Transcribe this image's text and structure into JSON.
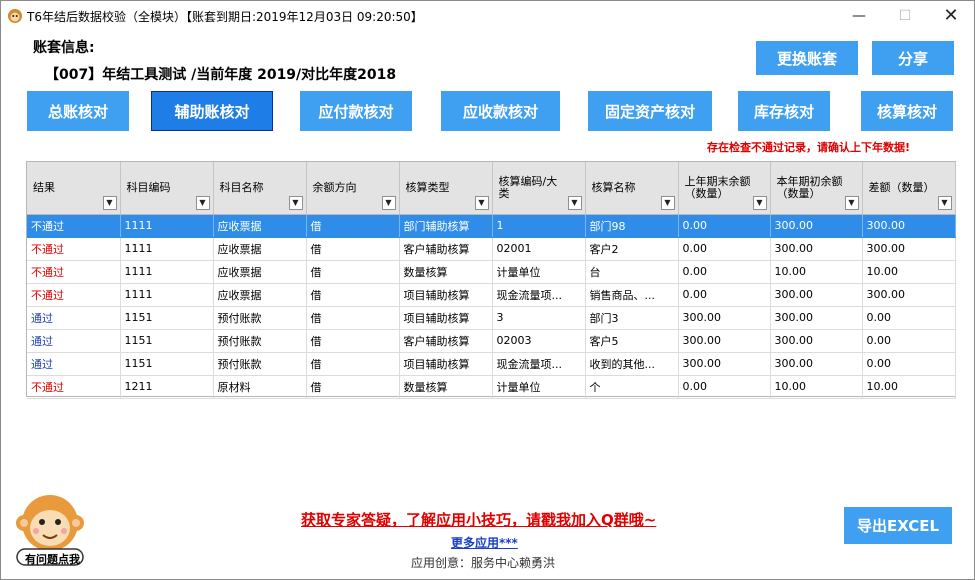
{
  "window": {
    "title": "T6年结后数据校验（全模块）【账套到期日:2019年12月03日 09:20:50】",
    "controls": {
      "minimize": "—",
      "maximize": "☐",
      "close": "✕"
    }
  },
  "account": {
    "label": "账套信息:",
    "info": "【007】年结工具测试 /当前年度 2019/对比年度2018"
  },
  "top_buttons": {
    "switch_account": "更换账套",
    "share": "分享"
  },
  "tabs": [
    {
      "label": "总账核对",
      "active": false
    },
    {
      "label": "辅助账核对",
      "active": true
    },
    {
      "label": "应付款核对",
      "active": false
    },
    {
      "label": "应收款核对",
      "active": false
    },
    {
      "label": "固定资产核对",
      "active": false
    },
    {
      "label": "库存核对",
      "active": false
    },
    {
      "label": "核算核对",
      "active": false
    }
  ],
  "warning": "存在检查不通过记录，请确认上下年数据!",
  "table": {
    "columns": [
      {
        "key": "result",
        "label": "结果"
      },
      {
        "key": "code",
        "label": "科目编码"
      },
      {
        "key": "name",
        "label": "科目名称"
      },
      {
        "key": "direction",
        "label": "余额方向"
      },
      {
        "key": "acc_type",
        "label": "核算类型"
      },
      {
        "key": "acc_code",
        "label": "核算编码/大类"
      },
      {
        "key": "acc_name",
        "label": "核算名称"
      },
      {
        "key": "prev_end",
        "label": "上年期末余额（数量）"
      },
      {
        "key": "curr_begin",
        "label": "本年期初余额（数量）"
      },
      {
        "key": "diff",
        "label": "差额（数量）"
      }
    ],
    "rows": [
      {
        "status": "fail",
        "cells": [
          "不通过",
          "1111",
          "应收票据",
          "借",
          "部门辅助核算",
          "1",
          "部门98",
          "0.00",
          "300.00",
          "300.00"
        ]
      },
      {
        "status": "fail",
        "cells": [
          "不通过",
          "1111",
          "应收票据",
          "借",
          "客户辅助核算",
          "02001",
          "客户2",
          "0.00",
          "300.00",
          "300.00"
        ]
      },
      {
        "status": "fail",
        "cells": [
          "不通过",
          "1111",
          "应收票据",
          "借",
          "数量核算",
          "计量单位",
          "台",
          "0.00",
          "10.00",
          "10.00"
        ]
      },
      {
        "status": "fail",
        "cells": [
          "不通过",
          "1111",
          "应收票据",
          "借",
          "项目辅助核算",
          "现金流量项...",
          "销售商品、...",
          "0.00",
          "300.00",
          "300.00"
        ]
      },
      {
        "status": "pass",
        "cells": [
          "通过",
          "1151",
          "预付账款",
          "借",
          "项目辅助核算",
          "3",
          "部门3",
          "300.00",
          "300.00",
          "0.00"
        ]
      },
      {
        "status": "pass",
        "cells": [
          "通过",
          "1151",
          "预付账款",
          "借",
          "客户辅助核算",
          "02003",
          "客户5",
          "300.00",
          "300.00",
          "0.00"
        ]
      },
      {
        "status": "pass",
        "cells": [
          "通过",
          "1151",
          "预付账款",
          "借",
          "项目辅助核算",
          "现金流量项...",
          "收到的其他...",
          "300.00",
          "300.00",
          "0.00"
        ]
      },
      {
        "status": "fail",
        "cells": [
          "不通过",
          "1211",
          "原材料",
          "借",
          "数量核算",
          "计量单位",
          "个",
          "0.00",
          "10.00",
          "10.00"
        ]
      }
    ],
    "selected_row": 0
  },
  "footer": {
    "mascot_caption": "有问题点我",
    "help_link": "获取专家答疑，了解应用小技巧，请戳我加入Q群哦~",
    "more_apps": "更多应用***",
    "credit": "应用创意：服务中心赖勇洪",
    "export_button": "导出EXCEL"
  },
  "colors": {
    "accent": "#3f9ff0",
    "selected_row": "#2f8ce8",
    "fail_text": "#e00000",
    "pass_text": "#1f3fb0"
  }
}
